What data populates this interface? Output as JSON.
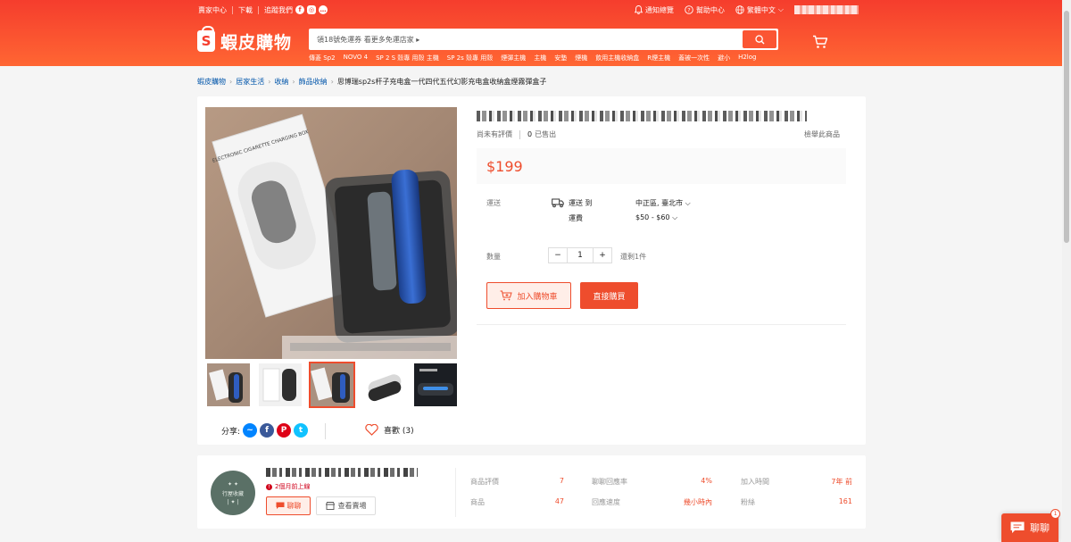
{
  "topbar": {
    "seller_center": "賣家中心",
    "download": "下載",
    "follow_us": "追蹤我們",
    "notifications": "通知總覽",
    "help": "幫助中心",
    "language": "繁體中文"
  },
  "header": {
    "logo_text": "蝦皮購物",
    "search_placeholder": "領18號免運券 看更多免運店家 ▸",
    "hints": [
      "傳菱 Sp2",
      "NOVO 4",
      "SP 2 S 殼專 用殼 主機",
      "SP 2s 殼專 用殼",
      "煙彈主機",
      "主機",
      "安墊",
      "煙機",
      "飲用主機收納盒",
      "R煙主機",
      "蓋被一次性",
      "避小",
      "H2log"
    ]
  },
  "breadcrumb": [
    "蝦皮購物",
    "居家生活",
    "收納",
    "飾品收納",
    "思博瑞sp2s杆子充电盒一代四代五代幻影充电盒收納盒煙霧彈盒子"
  ],
  "product": {
    "rating_text": "尚未有評價",
    "sold_count": "0",
    "sold_label": "已售出",
    "report": "檢舉此商品",
    "price": "$199",
    "shipping_label": "運送",
    "ship_to_label": "運送 到",
    "ship_location": "中正區, 臺北市",
    "ship_fee_label": "運費",
    "ship_fee": "$50 - $60",
    "quantity_label": "數量",
    "quantity": "1",
    "stock": "還剩1件",
    "add_to_cart": "加入購物車",
    "buy_now": "直接購買",
    "share_label": "分享:",
    "likes": "喜歡 (3)",
    "image_text": "ELECTRONIC CIGARETTE CHARGING BOX"
  },
  "shop": {
    "avatar_text": "行屋收藏",
    "online": "2個月前上線",
    "chat": "聊聊",
    "view_shop": "查看賣場",
    "stats": [
      {
        "label": "商品評價",
        "value": "7"
      },
      {
        "label": "聊聊回應率",
        "value": "4%"
      },
      {
        "label": "加入時間",
        "value": "7年 前"
      },
      {
        "label": "商品",
        "value": "47"
      },
      {
        "label": "回應速度",
        "value": "幾小時內"
      },
      {
        "label": "粉絲",
        "value": "161"
      }
    ]
  },
  "float_chat": {
    "label": "聊聊",
    "badge": "1"
  },
  "colors": {
    "brand": "#ee4d2d",
    "header_start": "#f53d2d",
    "header_end": "#ff6633"
  }
}
